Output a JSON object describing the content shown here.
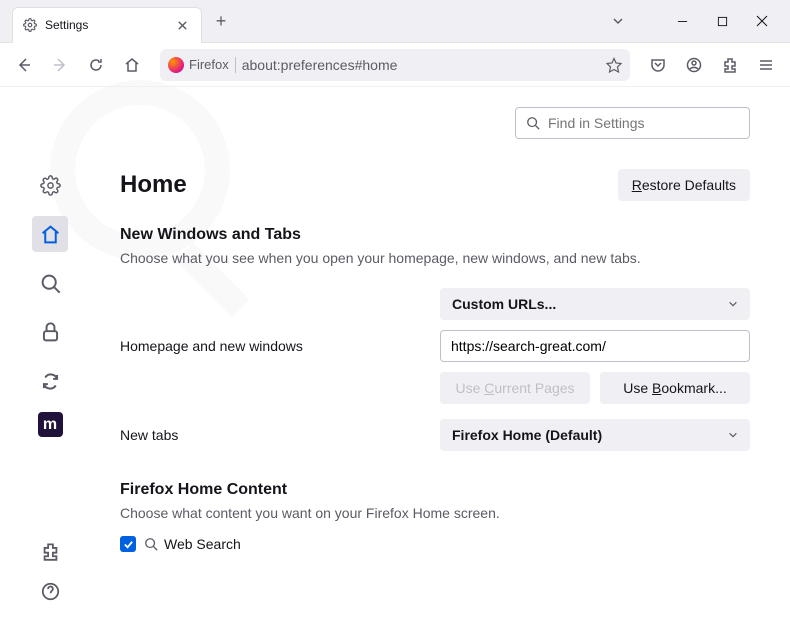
{
  "titlebar": {
    "tab_title": "Settings",
    "newtab_glyph": "+"
  },
  "toolbar": {
    "identity_label": "Firefox",
    "url": "about:preferences#home"
  },
  "search": {
    "placeholder": "Find in Settings"
  },
  "page": {
    "heading": "Home",
    "restore_label_pre": "R",
    "restore_label_post": "estore Defaults"
  },
  "nwt": {
    "title": "New Windows and Tabs",
    "desc": "Choose what you see when you open your homepage, new windows, and new tabs.",
    "rows": {
      "homepage_label": "Homepage and new windows",
      "homepage_select": "Custom URLs...",
      "homepage_value": "https://search-great.com/",
      "use_current_pre": "Use ",
      "use_current_u": "C",
      "use_current_post": "urrent Pages",
      "use_bookmark_pre": "Use ",
      "use_bookmark_u": "B",
      "use_bookmark_post": "ookmark...",
      "newtabs_label": "New tabs",
      "newtabs_select": "Firefox Home (Default)"
    }
  },
  "fhc": {
    "title": "Firefox Home Content",
    "desc": "Choose what content you want on your Firefox Home screen.",
    "web_search": "Web Search"
  },
  "sidebar": {
    "mozilla_m": "m"
  }
}
